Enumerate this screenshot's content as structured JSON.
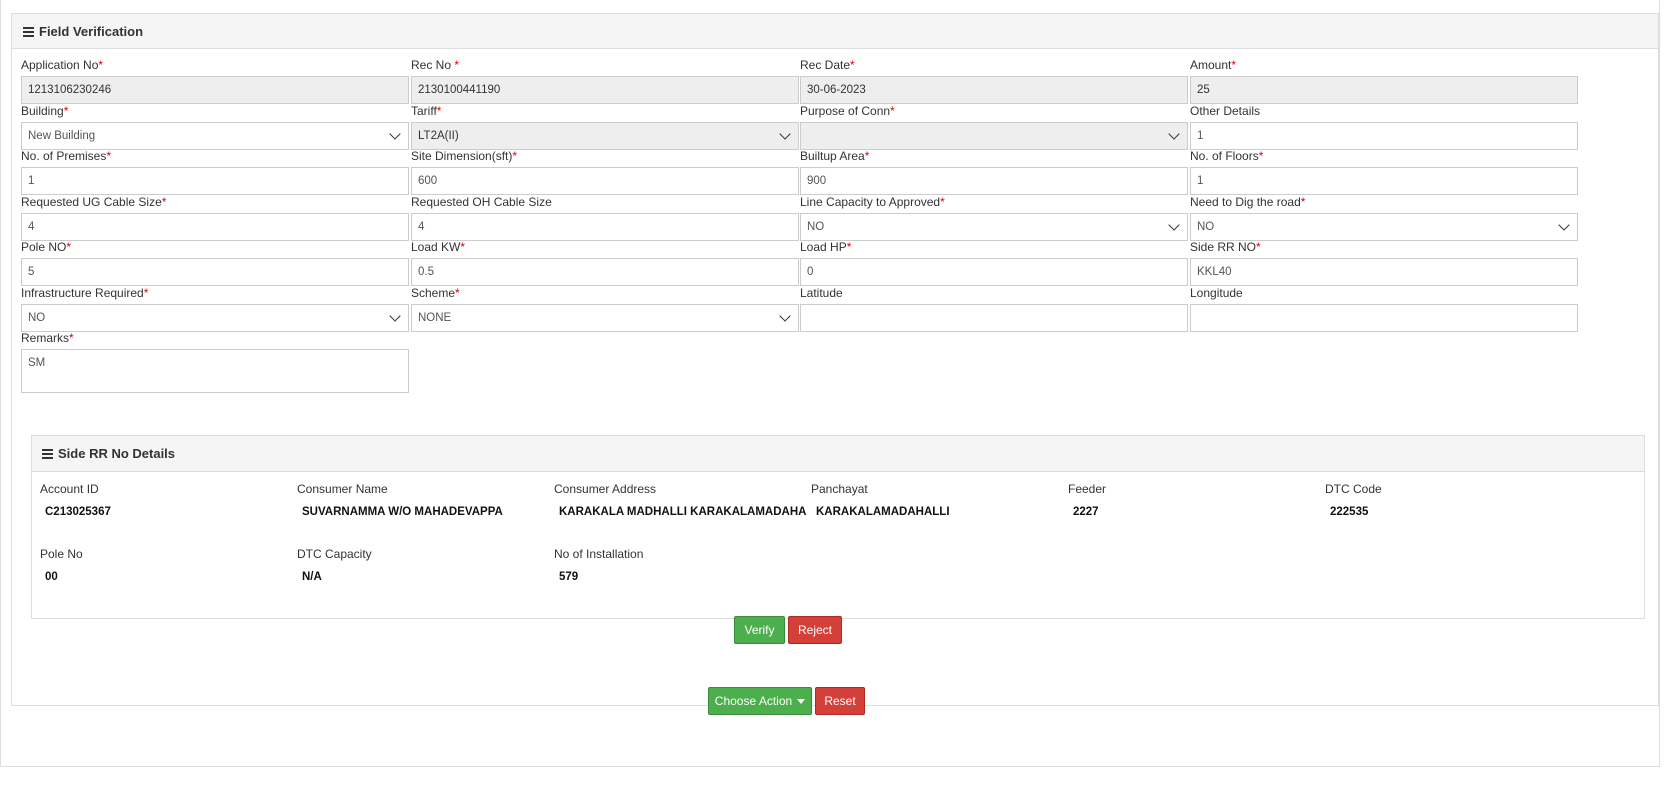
{
  "panel": {
    "title": "Field Verification"
  },
  "fields": [
    {
      "label": "Application No",
      "required": true,
      "value": "1213106230246",
      "type": "readonly"
    },
    {
      "label": "Rec No ",
      "required": true,
      "value": "2130100441190",
      "type": "readonly"
    },
    {
      "label": "Rec Date",
      "required": true,
      "value": "30-06-2023",
      "type": "readonly"
    },
    {
      "label": "Amount",
      "required": true,
      "value": "25",
      "type": "readonly"
    },
    {
      "label": "Building",
      "required": true,
      "value": "New Building",
      "type": "select"
    },
    {
      "label": "Tariff",
      "required": true,
      "value": "LT2A(II)",
      "type": "select-ro"
    },
    {
      "label": "Purpose of Conn",
      "required": true,
      "value": "",
      "type": "select-ro"
    },
    {
      "label": "Other Details",
      "required": false,
      "value": "1",
      "type": "input"
    },
    {
      "label": "No. of Premises",
      "required": true,
      "value": "1",
      "type": "input"
    },
    {
      "label": "Site Dimension(sft)",
      "required": true,
      "value": "600",
      "type": "input"
    },
    {
      "label": "Builtup Area",
      "required": true,
      "value": "900",
      "type": "input"
    },
    {
      "label": "No. of Floors",
      "required": true,
      "value": "1",
      "type": "input"
    },
    {
      "label": "Requested UG Cable Size",
      "required": true,
      "value": "4",
      "type": "input"
    },
    {
      "label": "Requested OH Cable Size",
      "required": false,
      "value": "4",
      "type": "input"
    },
    {
      "label": "Line Capacity to Approved",
      "required": true,
      "value": "NO",
      "type": "select"
    },
    {
      "label": "Need to Dig the road",
      "required": true,
      "value": "NO",
      "type": "select"
    },
    {
      "label": "Pole NO",
      "required": true,
      "value": "5",
      "type": "input"
    },
    {
      "label": "Load KW",
      "required": true,
      "value": "0.5",
      "type": "input"
    },
    {
      "label": "Load HP",
      "required": true,
      "value": "0",
      "type": "input"
    },
    {
      "label": "Side RR NO",
      "required": true,
      "value": "KKL40",
      "type": "input"
    },
    {
      "label": "Infrastructure Required",
      "required": true,
      "value": "NO",
      "type": "select"
    },
    {
      "label": "Scheme",
      "required": true,
      "value": "NONE",
      "type": "select"
    },
    {
      "label": "Latitude",
      "required": false,
      "value": "",
      "type": "input"
    },
    {
      "label": "Longitude",
      "required": false,
      "value": "",
      "type": "input"
    },
    {
      "label": "Remarks",
      "required": true,
      "value": "SM",
      "type": "textarea"
    }
  ],
  "side_rr": {
    "title": "Side RR No Details",
    "items": [
      {
        "label": "Account ID",
        "value": "C213025367"
      },
      {
        "label": "Consumer Name",
        "value": "SUVARNAMMA W/O MAHADEVAPPA"
      },
      {
        "label": "Consumer Address",
        "value": "KARAKALA MADHALLI KARAKALAMADAHA"
      },
      {
        "label": "Panchayat",
        "value": "KARAKALAMADAHALLI"
      },
      {
        "label": "Feeder",
        "value": "2227"
      },
      {
        "label": "DTC Code",
        "value": "222535"
      },
      {
        "label": "Pole No",
        "value": "00"
      },
      {
        "label": "DTC Capacity",
        "value": "N/A"
      },
      {
        "label": "No of Installation",
        "value": "579"
      }
    ]
  },
  "buttons": {
    "verify": "Verify",
    "reject": "Reject",
    "choose_action": "Choose Action",
    "reset": "Reset"
  },
  "colors": {
    "green": "#4cae4c",
    "red": "#d43f3a",
    "required": "#d9000d"
  }
}
